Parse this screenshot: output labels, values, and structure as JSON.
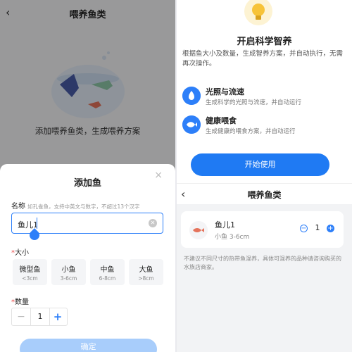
{
  "left": {
    "nav_title": "喂养鱼类",
    "empty_text": "添加喂养鱼类，生成喂养方案",
    "sheet": {
      "title": "添加鱼",
      "name_label": "名称",
      "name_hint": "如孔雀鱼，支持中英文与数字，不超过13个汉字",
      "name_value": "鱼儿1",
      "size_label": "大小",
      "sizes": [
        {
          "name": "微型鱼",
          "range": "<3cm"
        },
        {
          "name": "小鱼",
          "range": "3-6cm"
        },
        {
          "name": "中鱼",
          "range": "6-8cm"
        },
        {
          "name": "大鱼",
          "range": ">8cm"
        }
      ],
      "qty_label": "数量",
      "qty_value": "1",
      "minus_symbol": "−",
      "plus_symbol": "+",
      "confirm_label": "确定",
      "required_mark": "*",
      "close_symbol": "×"
    }
  },
  "right": {
    "heading": "开启科学智养",
    "description": "根据鱼大小及数量，生成智养方案，并自动执行，无需再次操作。",
    "features": [
      {
        "title": "光照与流速",
        "subtitle": "生成科学的光照与流速，并自动运行",
        "icon": "sun-water-icon"
      },
      {
        "title": "健康喂食",
        "subtitle": "生成健康的喂食方案，并自动运行",
        "icon": "fish-feed-icon"
      }
    ],
    "start_label": "开始使用",
    "nav_title": "喂养鱼类",
    "fish": {
      "name": "鱼儿1",
      "meta": "小鱼 3-6cm",
      "qty": "1"
    },
    "note": "不建议不同尺寸的热带鱼混养，具体可混养的品种请咨询购买的水族店商家。"
  },
  "colors": {
    "accent": "#1f7af3",
    "confirm_disabled": "#a8cdfb"
  }
}
